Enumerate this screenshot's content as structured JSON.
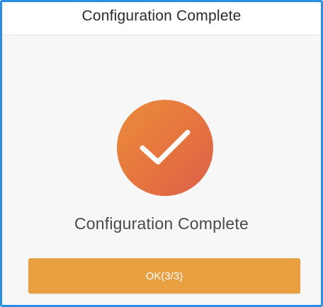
{
  "header": {
    "title": "Configuration Complete"
  },
  "status": {
    "icon": "checkmark-icon",
    "message": "Configuration Complete"
  },
  "actions": {
    "ok_label": "OK(3/3)"
  },
  "colors": {
    "frame_border": "#2a8fe0",
    "accent_start": "#e98c3a",
    "accent_end": "#dd5e48",
    "button": "#e8a041"
  }
}
